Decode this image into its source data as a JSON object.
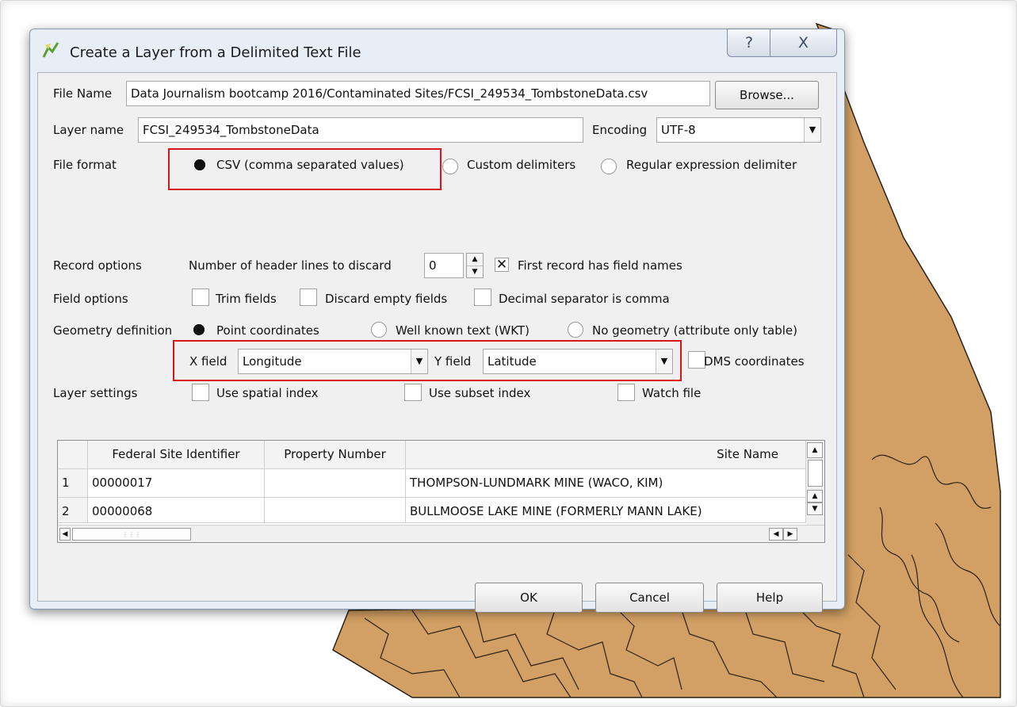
{
  "dialog": {
    "title": "Create a Layer from a Delimited Text File",
    "help_glyph": "?",
    "close_glyph": "X"
  },
  "file_name": {
    "label": "File Name",
    "value": "Data Journalism bootcamp 2016/Contaminated Sites/FCSI_249534_TombstoneData.csv",
    "browse_label": "Browse..."
  },
  "layer_name": {
    "label": "Layer name",
    "value": "FCSI_249534_TombstoneData"
  },
  "encoding": {
    "label": "Encoding",
    "value": "UTF-8"
  },
  "file_format": {
    "label": "File format",
    "options": [
      "CSV (comma separated values)",
      "Custom delimiters",
      "Regular expression delimiter"
    ],
    "selected": "CSV (comma separated values)"
  },
  "record_options": {
    "label": "Record options",
    "header_lines_label": "Number of header lines to discard",
    "header_lines_value": "0",
    "first_record_label": "First record has field names",
    "first_record_checked": true
  },
  "field_options": {
    "label": "Field options",
    "trim_label": "Trim fields",
    "discard_label": "Discard empty fields",
    "decimal_label": "Decimal separator is comma"
  },
  "geometry": {
    "label": "Geometry definition",
    "options": [
      "Point coordinates",
      "Well known text (WKT)",
      "No geometry (attribute only table)"
    ],
    "selected": "Point coordinates",
    "x_label": "X field",
    "x_value": "Longitude",
    "y_label": "Y field",
    "y_value": "Latitude",
    "dms_label": "DMS coordinates"
  },
  "layer_settings": {
    "label": "Layer settings",
    "spatial_index_label": "Use spatial index",
    "subset_index_label": "Use subset index",
    "watch_file_label": "Watch file"
  },
  "preview_table": {
    "columns": [
      "Federal Site Identifier",
      "Property Number",
      "Site Name"
    ],
    "rows": [
      {
        "num": "1",
        "cells": [
          "00000017",
          "",
          "THOMPSON-LUNDMARK MINE (WACO, KIM)"
        ]
      },
      {
        "num": "2",
        "cells": [
          "00000068",
          "",
          "BULLMOOSE LAKE MINE (FORMERLY MANN LAKE)"
        ]
      }
    ]
  },
  "buttons": {
    "ok": "OK",
    "cancel": "Cancel",
    "help": "Help"
  },
  "colors": {
    "highlight": "#d9161d",
    "map_fill": "#d2a064",
    "dialog_frame": "#e7eef6"
  }
}
